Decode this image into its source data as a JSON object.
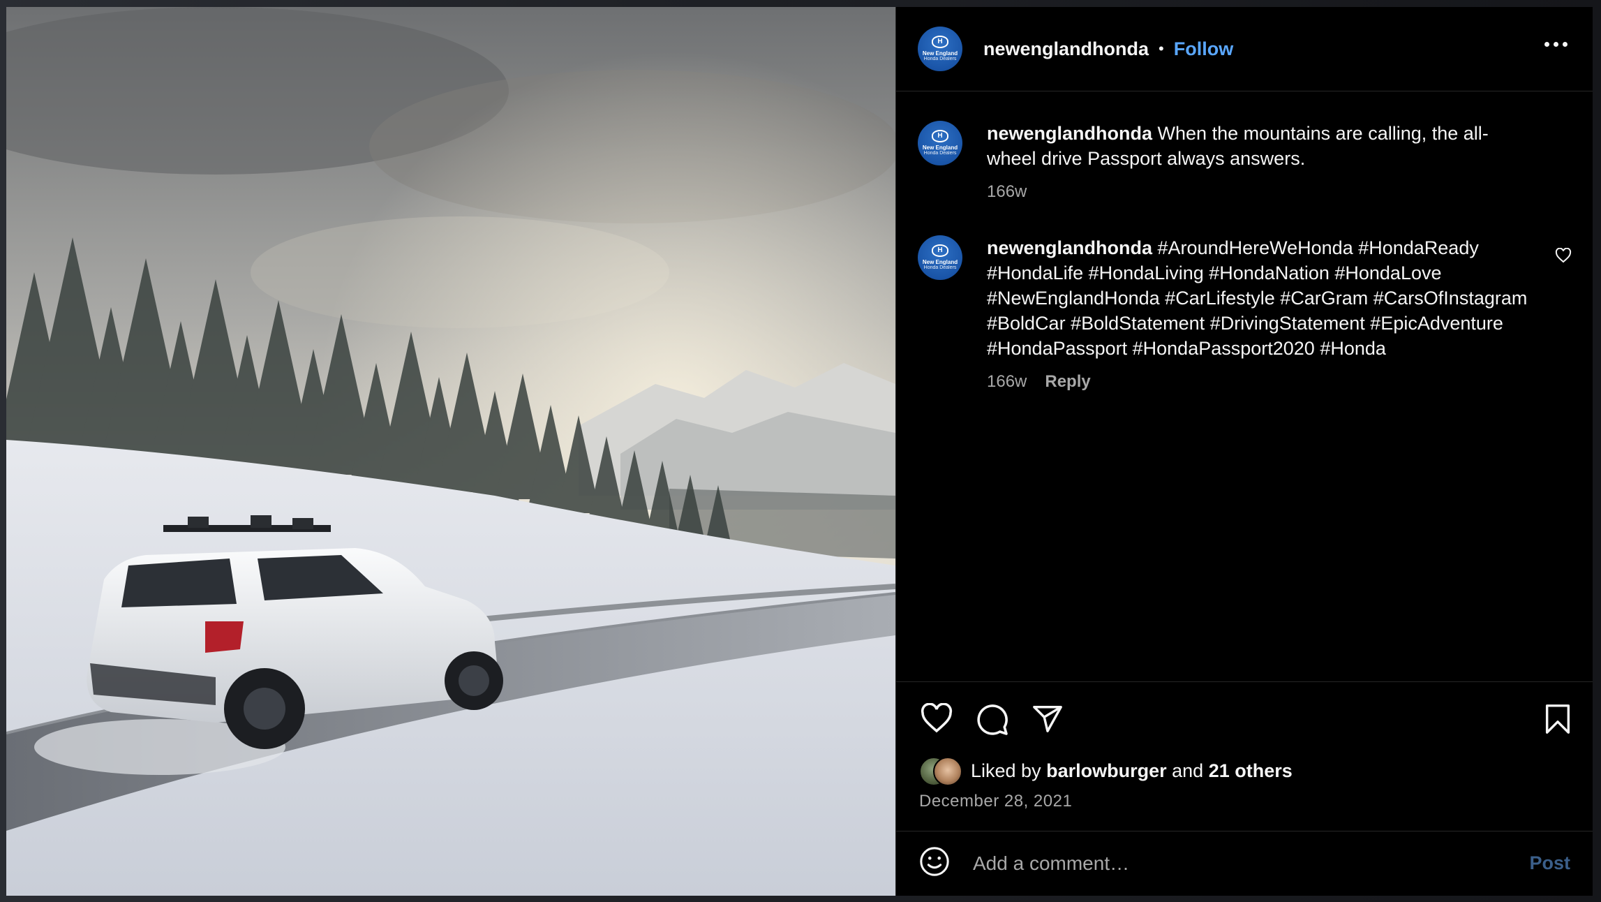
{
  "colors": {
    "accent": "#5aa7ff",
    "post_disabled": "#3b5f8a",
    "muted": "#a8a8a8",
    "background": "#000000"
  },
  "post": {
    "image_alt": "White Honda Passport SUV with roof ski rack driving on a snowy mountain road past snow-covered pine trees",
    "account": {
      "username": "newenglandhonda",
      "avatar_mark": "H",
      "avatar_line1": "New England",
      "avatar_line2": "Honda Dealers"
    },
    "header": {
      "separator": "•",
      "follow_label": "Follow",
      "more_icon": "more-horizontal-icon"
    },
    "caption": {
      "username": "newenglandhonda",
      "text": "When the mountains are calling, the all-wheel drive Passport always answers.",
      "age": "166w"
    },
    "comments": [
      {
        "username": "newenglandhonda",
        "text": "#AroundHereWeHonda #HondaReady #HondaLife #HondaLiving #HondaNation #HondaLove #NewEnglandHonda #CarLifestyle #CarGram #CarsOfInstagram #BoldCar #BoldStatement #DrivingStatement #EpicAdventure #HondaPassport #HondaPassport2020 #Honda",
        "age": "166w",
        "reply_label": "Reply",
        "like_icon": "heart-icon"
      }
    ],
    "actions": {
      "icons": [
        "heart-icon",
        "comment-icon",
        "share-icon",
        "bookmark-icon"
      ]
    },
    "likes": {
      "prefix": "Liked by",
      "user": "barlowburger",
      "conjunction": "and",
      "others": "21 others"
    },
    "date": "December 28, 2021",
    "add_comment": {
      "placeholder": "Add a comment…",
      "post_label": "Post",
      "emoji_icon": "emoji-icon"
    }
  }
}
